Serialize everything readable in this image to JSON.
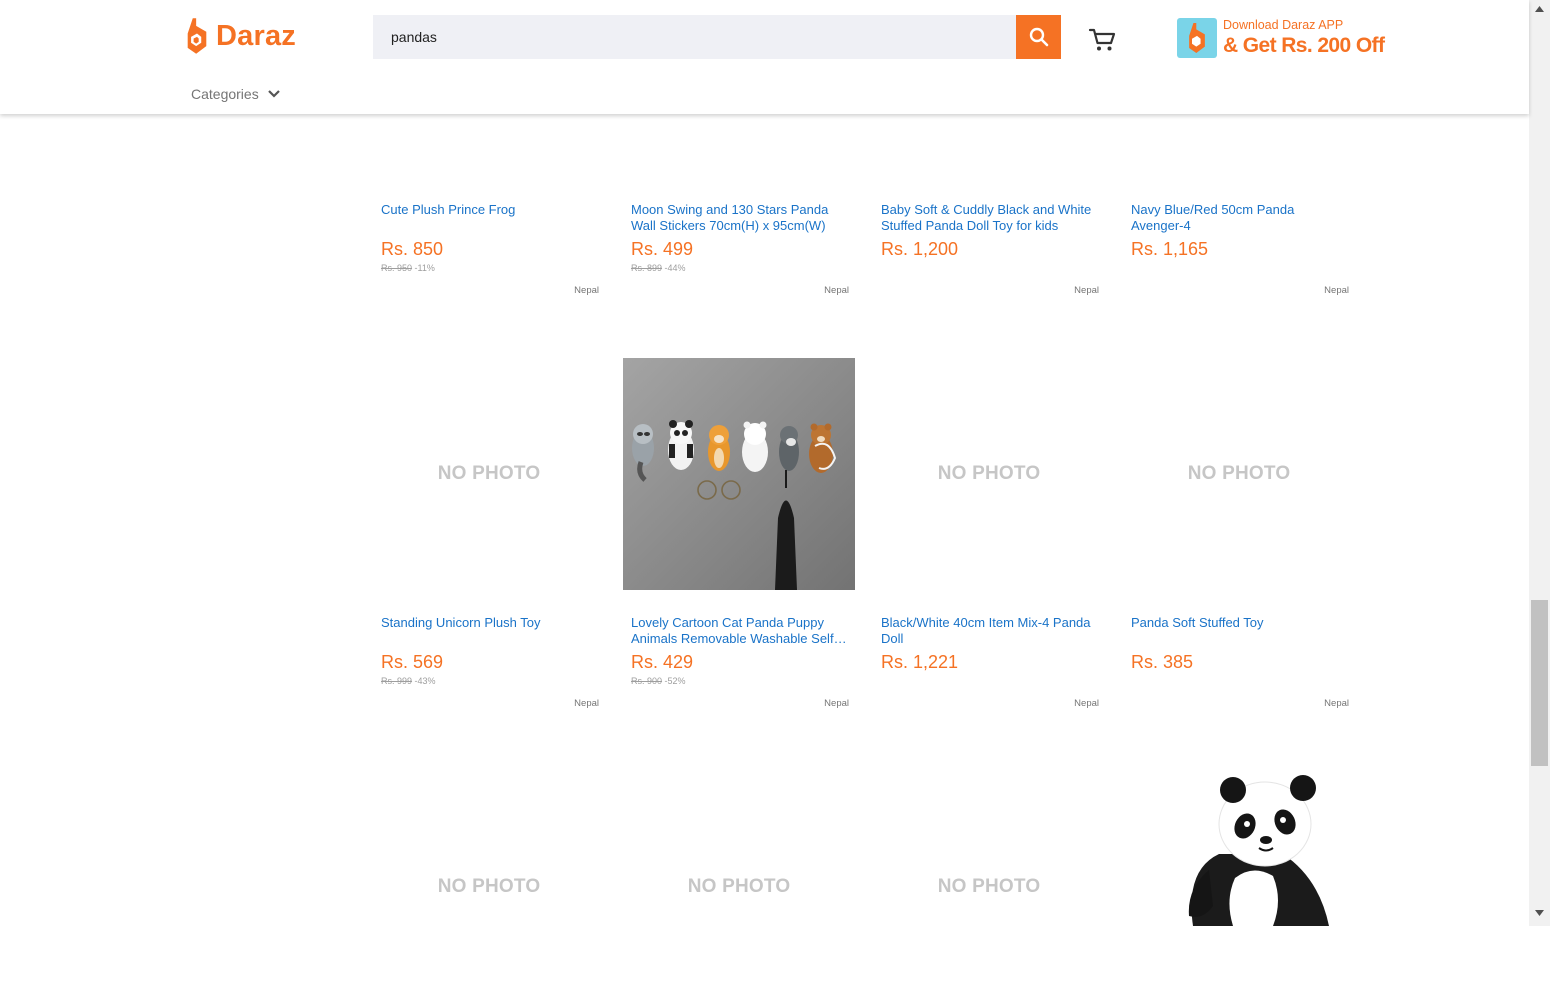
{
  "header": {
    "brand": "Daraz",
    "search_value": "pandas",
    "promo_line1": "Download Daraz APP",
    "promo_line2": "& Get Rs. 200 Off",
    "categories_label": "Categories"
  },
  "colors": {
    "brand": "#f57224",
    "link": "#1a73c8",
    "search_bg": "#eff0f5",
    "no_photo": "#c6c6c6"
  },
  "products": [
    {
      "title": "Cute Plush Prince Frog",
      "price": "Rs. 850",
      "old_price": "Rs. 950",
      "discount": "-11%",
      "location": "Nepal",
      "photo": "hidden"
    },
    {
      "title": "Moon Swing and 130 Stars Panda Wall Stickers 70cm(H) x 95cm(W)",
      "price": "Rs. 499",
      "old_price": "Rs. 899",
      "discount": "-44%",
      "location": "Nepal",
      "photo": "hidden"
    },
    {
      "title": "Baby Soft & Cuddly Black and White Stuffed Panda Doll Toy for kids",
      "price": "Rs. 1,200",
      "old_price": "",
      "discount": "",
      "location": "Nepal",
      "photo": "hidden"
    },
    {
      "title": "Navy Blue/Red 50cm Panda Avenger-4",
      "price": "Rs. 1,165",
      "old_price": "",
      "discount": "",
      "location": "Nepal",
      "photo": "hidden"
    },
    {
      "title": "Standing Unicorn Plush Toy",
      "price": "Rs. 569",
      "old_price": "Rs. 999",
      "discount": "-43%",
      "location": "Nepal",
      "photo": "NO PHOTO"
    },
    {
      "title": "Lovely Cartoon Cat Panda Puppy Animals Removable Washable Self Adhesive Hooks",
      "price": "Rs. 429",
      "old_price": "Rs. 900",
      "discount": "-52%",
      "location": "Nepal",
      "photo": "animal-hooks-image"
    },
    {
      "title": "Black/White 40cm Item Mix-4 Panda Doll",
      "price": "Rs. 1,221",
      "old_price": "",
      "discount": "",
      "location": "Nepal",
      "photo": "NO PHOTO"
    },
    {
      "title": "Panda Soft Stuffed Toy",
      "price": "Rs. 385",
      "old_price": "",
      "discount": "",
      "location": "Nepal",
      "photo": "NO PHOTO"
    },
    {
      "photo": "NO PHOTO"
    },
    {
      "photo": "NO PHOTO"
    },
    {
      "photo": "NO PHOTO"
    },
    {
      "photo": "panda-plush-image"
    }
  ],
  "no_photo_text": "NO PHOTO"
}
